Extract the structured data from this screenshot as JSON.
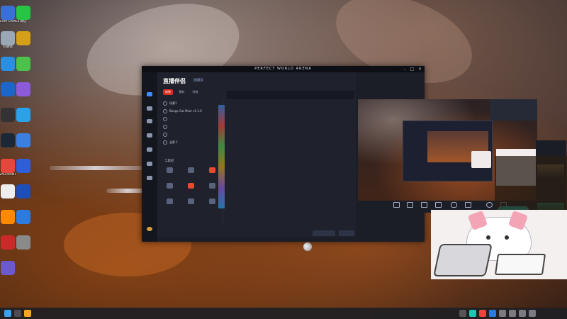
{
  "desktop": {
    "icons": [
      {
        "label": "STEAM GAMES",
        "color": "#3a6fd8"
      },
      {
        "label": "微信",
        "color": "#28c445"
      },
      {
        "label": "回收站",
        "color": "#9aa7b5"
      },
      {
        "label": "",
        "color": "#d4a017"
      },
      {
        "label": "",
        "color": "#2a8fe0"
      },
      {
        "label": "",
        "color": "#4cc24a"
      },
      {
        "label": "",
        "color": "#1c66c9"
      },
      {
        "label": "",
        "color": "#8c5bd9"
      },
      {
        "label": "",
        "color": "#333333"
      },
      {
        "label": "",
        "color": "#2aa1e8"
      },
      {
        "label": "",
        "color": "#1b2838"
      },
      {
        "label": "",
        "color": "#3b7fe0"
      },
      {
        "label": "VALORANT",
        "color": "#e8453c"
      },
      {
        "label": "",
        "color": "#2e5fd9"
      },
      {
        "label": "",
        "color": "#eeeeee"
      },
      {
        "label": "",
        "color": "#1e4fb8"
      },
      {
        "label": "",
        "color": "#ff8a00"
      },
      {
        "label": "",
        "color": "#2d7be0"
      },
      {
        "label": "",
        "color": "#cc2a2a"
      },
      {
        "label": "",
        "color": "#8a8a8a"
      },
      {
        "label": "",
        "color": "#6a5acd"
      }
    ]
  },
  "app": {
    "window_title": "PERFECT WORLD ARENA",
    "brand": "直播伴侣",
    "version_badge": "内测 4",
    "tabs": [
      "场景",
      "素材",
      "特效"
    ],
    "scenes": [
      "场景1",
      "Bongo Cat Mver v1.1.6",
      "",
      "",
      "",
      "全屏 1"
    ],
    "tools_title": "工具栏",
    "tools": [
      {
        "label": "",
        "red": false
      },
      {
        "label": "",
        "red": false
      },
      {
        "label": "",
        "red": true
      },
      {
        "label": "",
        "red": false
      },
      {
        "label": "",
        "red": true
      },
      {
        "label": "",
        "red": false
      },
      {
        "label": "",
        "red": false
      },
      {
        "label": "",
        "red": false
      },
      {
        "label": "",
        "red": false
      }
    ],
    "bottom_note": "",
    "preview_header": "",
    "controls": [
      "",
      "",
      "",
      "",
      "",
      "",
      "",
      ""
    ],
    "go_live_label": "",
    "bottom_buttons": [
      "",
      ""
    ]
  },
  "overlay": {
    "notes": [
      "",
      "",
      "",
      ""
    ]
  },
  "taskbar": {
    "time": "",
    "date": ""
  }
}
